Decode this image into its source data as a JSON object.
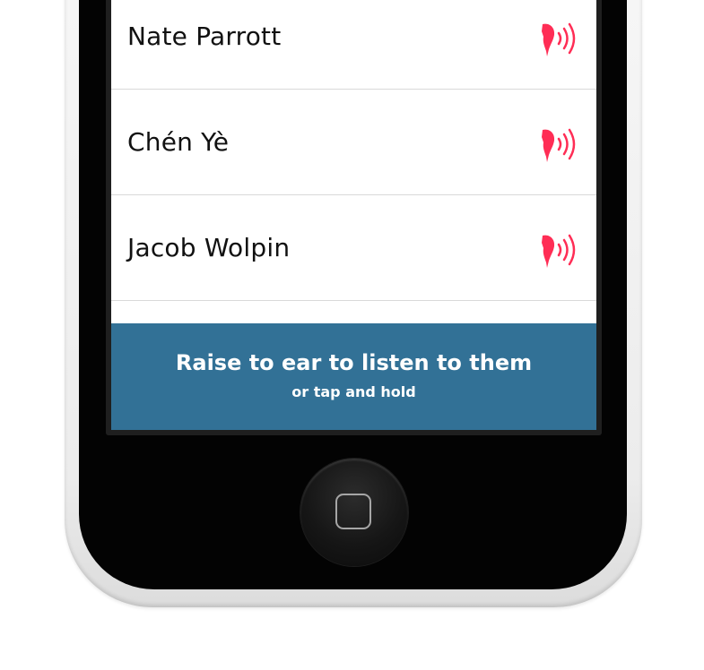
{
  "contacts": [
    {
      "name": "Nate Parrott",
      "icon": "parrot-sound-icon"
    },
    {
      "name": "Chén Yè",
      "icon": "parrot-sound-icon"
    },
    {
      "name": "Jacob Wolpin",
      "icon": "parrot-sound-icon"
    }
  ],
  "banner": {
    "title": "Raise to ear to listen to them",
    "subtitle": "or tap and hold"
  },
  "colors": {
    "accent": "#ff2d55",
    "banner": "#327196",
    "text": "#111111",
    "divider": "#d9d9d9"
  },
  "device": {
    "home_button_icon": "home-square-icon"
  }
}
